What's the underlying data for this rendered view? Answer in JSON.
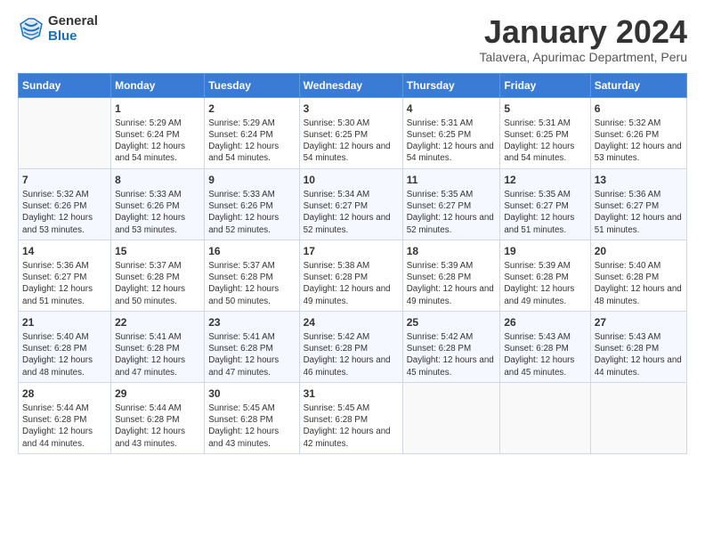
{
  "logo": {
    "line1": "General",
    "line2": "Blue"
  },
  "title": "January 2024",
  "subtitle": "Talavera, Apurimac Department, Peru",
  "weekdays": [
    "Sunday",
    "Monday",
    "Tuesday",
    "Wednesday",
    "Thursday",
    "Friday",
    "Saturday"
  ],
  "weeks": [
    [
      {
        "day": "",
        "sunrise": "",
        "sunset": "",
        "daylight": ""
      },
      {
        "day": "1",
        "sunrise": "Sunrise: 5:29 AM",
        "sunset": "Sunset: 6:24 PM",
        "daylight": "Daylight: 12 hours and 54 minutes."
      },
      {
        "day": "2",
        "sunrise": "Sunrise: 5:29 AM",
        "sunset": "Sunset: 6:24 PM",
        "daylight": "Daylight: 12 hours and 54 minutes."
      },
      {
        "day": "3",
        "sunrise": "Sunrise: 5:30 AM",
        "sunset": "Sunset: 6:25 PM",
        "daylight": "Daylight: 12 hours and 54 minutes."
      },
      {
        "day": "4",
        "sunrise": "Sunrise: 5:31 AM",
        "sunset": "Sunset: 6:25 PM",
        "daylight": "Daylight: 12 hours and 54 minutes."
      },
      {
        "day": "5",
        "sunrise": "Sunrise: 5:31 AM",
        "sunset": "Sunset: 6:25 PM",
        "daylight": "Daylight: 12 hours and 54 minutes."
      },
      {
        "day": "6",
        "sunrise": "Sunrise: 5:32 AM",
        "sunset": "Sunset: 6:26 PM",
        "daylight": "Daylight: 12 hours and 53 minutes."
      }
    ],
    [
      {
        "day": "7",
        "sunrise": "Sunrise: 5:32 AM",
        "sunset": "Sunset: 6:26 PM",
        "daylight": "Daylight: 12 hours and 53 minutes."
      },
      {
        "day": "8",
        "sunrise": "Sunrise: 5:33 AM",
        "sunset": "Sunset: 6:26 PM",
        "daylight": "Daylight: 12 hours and 53 minutes."
      },
      {
        "day": "9",
        "sunrise": "Sunrise: 5:33 AM",
        "sunset": "Sunset: 6:26 PM",
        "daylight": "Daylight: 12 hours and 52 minutes."
      },
      {
        "day": "10",
        "sunrise": "Sunrise: 5:34 AM",
        "sunset": "Sunset: 6:27 PM",
        "daylight": "Daylight: 12 hours and 52 minutes."
      },
      {
        "day": "11",
        "sunrise": "Sunrise: 5:35 AM",
        "sunset": "Sunset: 6:27 PM",
        "daylight": "Daylight: 12 hours and 52 minutes."
      },
      {
        "day": "12",
        "sunrise": "Sunrise: 5:35 AM",
        "sunset": "Sunset: 6:27 PM",
        "daylight": "Daylight: 12 hours and 51 minutes."
      },
      {
        "day": "13",
        "sunrise": "Sunrise: 5:36 AM",
        "sunset": "Sunset: 6:27 PM",
        "daylight": "Daylight: 12 hours and 51 minutes."
      }
    ],
    [
      {
        "day": "14",
        "sunrise": "Sunrise: 5:36 AM",
        "sunset": "Sunset: 6:27 PM",
        "daylight": "Daylight: 12 hours and 51 minutes."
      },
      {
        "day": "15",
        "sunrise": "Sunrise: 5:37 AM",
        "sunset": "Sunset: 6:28 PM",
        "daylight": "Daylight: 12 hours and 50 minutes."
      },
      {
        "day": "16",
        "sunrise": "Sunrise: 5:37 AM",
        "sunset": "Sunset: 6:28 PM",
        "daylight": "Daylight: 12 hours and 50 minutes."
      },
      {
        "day": "17",
        "sunrise": "Sunrise: 5:38 AM",
        "sunset": "Sunset: 6:28 PM",
        "daylight": "Daylight: 12 hours and 49 minutes."
      },
      {
        "day": "18",
        "sunrise": "Sunrise: 5:39 AM",
        "sunset": "Sunset: 6:28 PM",
        "daylight": "Daylight: 12 hours and 49 minutes."
      },
      {
        "day": "19",
        "sunrise": "Sunrise: 5:39 AM",
        "sunset": "Sunset: 6:28 PM",
        "daylight": "Daylight: 12 hours and 49 minutes."
      },
      {
        "day": "20",
        "sunrise": "Sunrise: 5:40 AM",
        "sunset": "Sunset: 6:28 PM",
        "daylight": "Daylight: 12 hours and 48 minutes."
      }
    ],
    [
      {
        "day": "21",
        "sunrise": "Sunrise: 5:40 AM",
        "sunset": "Sunset: 6:28 PM",
        "daylight": "Daylight: 12 hours and 48 minutes."
      },
      {
        "day": "22",
        "sunrise": "Sunrise: 5:41 AM",
        "sunset": "Sunset: 6:28 PM",
        "daylight": "Daylight: 12 hours and 47 minutes."
      },
      {
        "day": "23",
        "sunrise": "Sunrise: 5:41 AM",
        "sunset": "Sunset: 6:28 PM",
        "daylight": "Daylight: 12 hours and 47 minutes."
      },
      {
        "day": "24",
        "sunrise": "Sunrise: 5:42 AM",
        "sunset": "Sunset: 6:28 PM",
        "daylight": "Daylight: 12 hours and 46 minutes."
      },
      {
        "day": "25",
        "sunrise": "Sunrise: 5:42 AM",
        "sunset": "Sunset: 6:28 PM",
        "daylight": "Daylight: 12 hours and 45 minutes."
      },
      {
        "day": "26",
        "sunrise": "Sunrise: 5:43 AM",
        "sunset": "Sunset: 6:28 PM",
        "daylight": "Daylight: 12 hours and 45 minutes."
      },
      {
        "day": "27",
        "sunrise": "Sunrise: 5:43 AM",
        "sunset": "Sunset: 6:28 PM",
        "daylight": "Daylight: 12 hours and 44 minutes."
      }
    ],
    [
      {
        "day": "28",
        "sunrise": "Sunrise: 5:44 AM",
        "sunset": "Sunset: 6:28 PM",
        "daylight": "Daylight: 12 hours and 44 minutes."
      },
      {
        "day": "29",
        "sunrise": "Sunrise: 5:44 AM",
        "sunset": "Sunset: 6:28 PM",
        "daylight": "Daylight: 12 hours and 43 minutes."
      },
      {
        "day": "30",
        "sunrise": "Sunrise: 5:45 AM",
        "sunset": "Sunset: 6:28 PM",
        "daylight": "Daylight: 12 hours and 43 minutes."
      },
      {
        "day": "31",
        "sunrise": "Sunrise: 5:45 AM",
        "sunset": "Sunset: 6:28 PM",
        "daylight": "Daylight: 12 hours and 42 minutes."
      },
      {
        "day": "",
        "sunrise": "",
        "sunset": "",
        "daylight": ""
      },
      {
        "day": "",
        "sunrise": "",
        "sunset": "",
        "daylight": ""
      },
      {
        "day": "",
        "sunrise": "",
        "sunset": "",
        "daylight": ""
      }
    ]
  ]
}
